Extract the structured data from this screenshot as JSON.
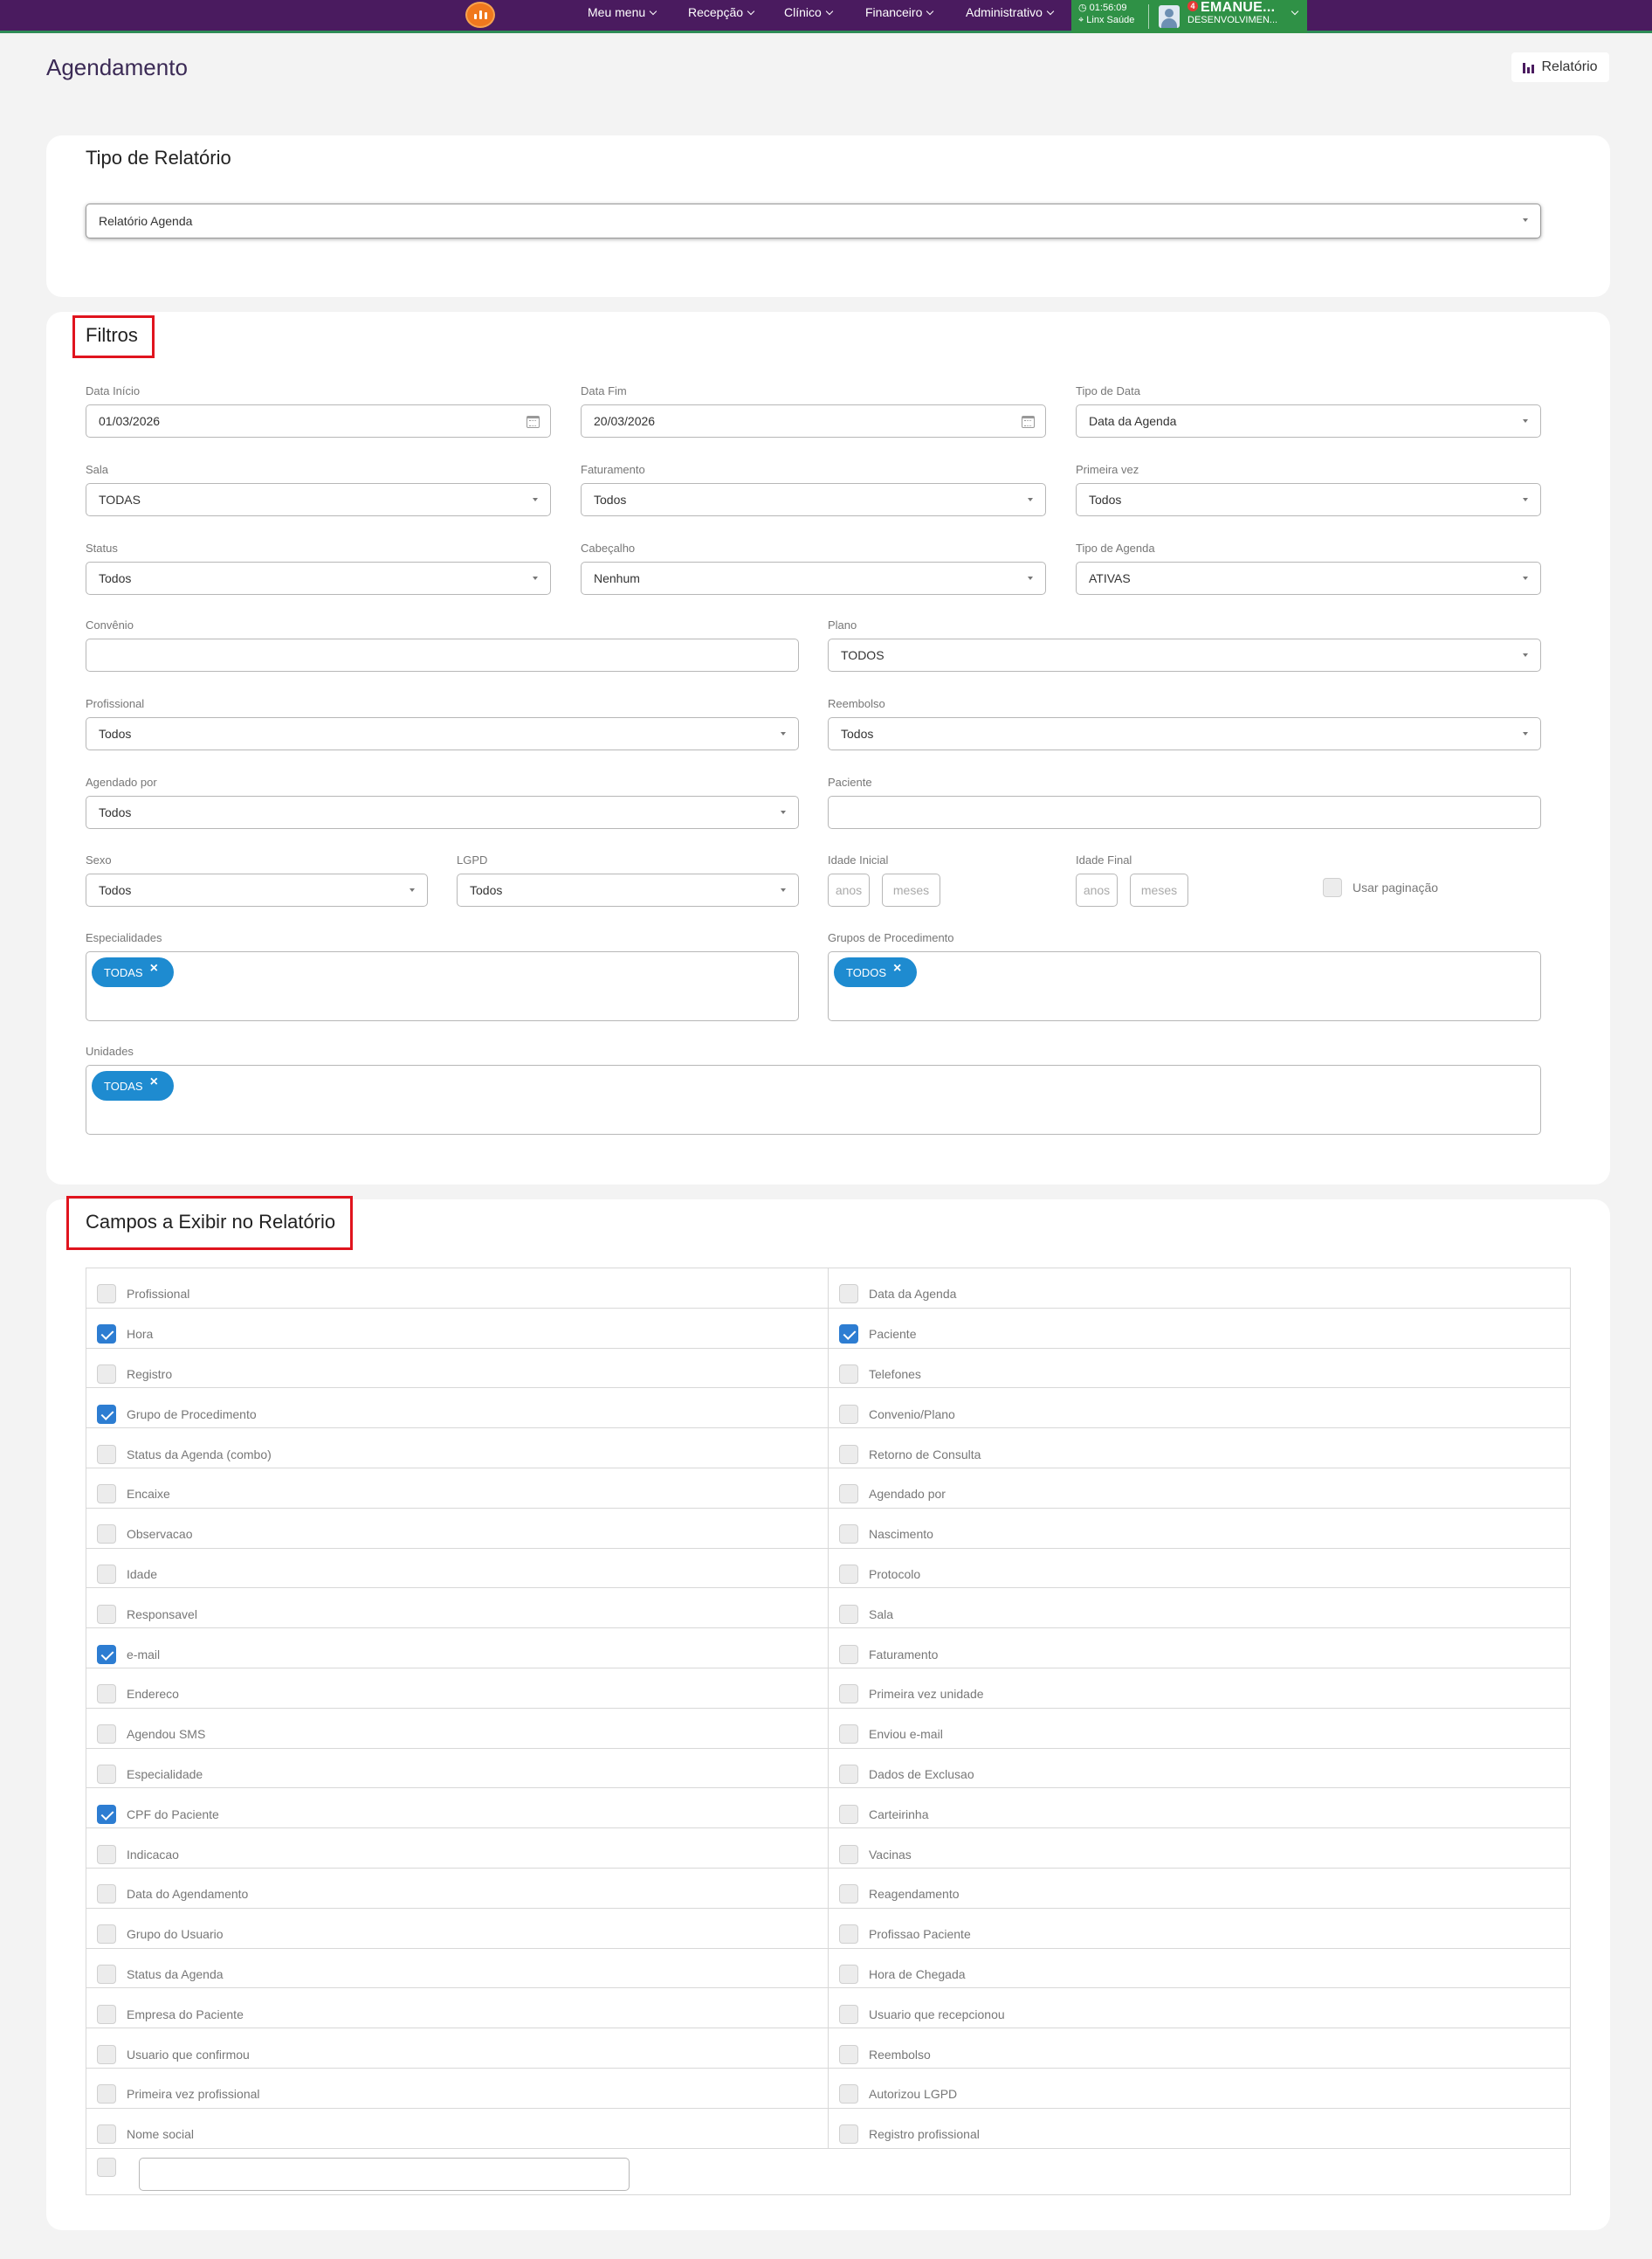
{
  "nav": {
    "menus": [
      "Meu menu",
      "Recepção",
      "Clínico",
      "Financeiro",
      "Administrativo"
    ],
    "time": "01:56:09",
    "location": "Linx Saúde",
    "notif_count": "4",
    "user_name": "EMANUE...",
    "user_role": "DESENVOLVIMEN..."
  },
  "page": {
    "title": "Agendamento",
    "report_button": "Relatório"
  },
  "tipo": {
    "title": "Tipo de Relatório",
    "value": "Relatório Agenda"
  },
  "filtros": {
    "title": "Filtros",
    "data_inicio": {
      "label": "Data Início",
      "value": "01/03/2026"
    },
    "data_fim": {
      "label": "Data Fim",
      "value": "20/03/2026"
    },
    "tipo_data": {
      "label": "Tipo de Data",
      "value": "Data da Agenda"
    },
    "sala": {
      "label": "Sala",
      "value": "TODAS"
    },
    "faturamento": {
      "label": "Faturamento",
      "value": "Todos"
    },
    "primeira_vez": {
      "label": "Primeira vez",
      "value": "Todos"
    },
    "status": {
      "label": "Status",
      "value": "Todos"
    },
    "cabecalho": {
      "label": "Cabeçalho",
      "value": "Nenhum"
    },
    "tipo_agenda": {
      "label": "Tipo de Agenda",
      "value": "ATIVAS"
    },
    "convenio": {
      "label": "Convênio",
      "value": ""
    },
    "plano": {
      "label": "Plano",
      "value": "TODOS"
    },
    "profissional": {
      "label": "Profissional",
      "value": "Todos"
    },
    "reembolso": {
      "label": "Reembolso",
      "value": "Todos"
    },
    "agendado_por": {
      "label": "Agendado por",
      "value": "Todos"
    },
    "paciente": {
      "label": "Paciente",
      "value": ""
    },
    "sexo": {
      "label": "Sexo",
      "value": "Todos"
    },
    "lgpd": {
      "label": "LGPD",
      "value": "Todos"
    },
    "idade_inicial": {
      "label": "Idade Inicial",
      "anos_placeholder": "anos",
      "meses_placeholder": "meses"
    },
    "idade_final": {
      "label": "Idade Final",
      "anos_placeholder": "anos",
      "meses_placeholder": "meses"
    },
    "usar_paginacao": {
      "label": "Usar paginação",
      "checked": false
    },
    "especialidades": {
      "label": "Especialidades",
      "tag": "TODAS"
    },
    "grupos_procedimento": {
      "label": "Grupos de Procedimento",
      "tag": "TODOS"
    },
    "unidades": {
      "label": "Unidades",
      "tag": "TODAS"
    }
  },
  "campos": {
    "title": "Campos a Exibir no Relatório",
    "rows": [
      [
        {
          "label": "Profissional",
          "checked": false
        },
        {
          "label": "Data da Agenda",
          "checked": false
        }
      ],
      [
        {
          "label": "Hora",
          "checked": true
        },
        {
          "label": "Paciente",
          "checked": true
        }
      ],
      [
        {
          "label": "Registro",
          "checked": false
        },
        {
          "label": "Telefones",
          "checked": false
        }
      ],
      [
        {
          "label": "Grupo de Procedimento",
          "checked": true
        },
        {
          "label": "Convenio/Plano",
          "checked": false
        }
      ],
      [
        {
          "label": "Status da Agenda (combo)",
          "checked": false
        },
        {
          "label": "Retorno de Consulta",
          "checked": false
        }
      ],
      [
        {
          "label": "Encaixe",
          "checked": false
        },
        {
          "label": "Agendado por",
          "checked": false
        }
      ],
      [
        {
          "label": "Observacao",
          "checked": false
        },
        {
          "label": "Nascimento",
          "checked": false
        }
      ],
      [
        {
          "label": "Idade",
          "checked": false
        },
        {
          "label": "Protocolo",
          "checked": false
        }
      ],
      [
        {
          "label": "Responsavel",
          "checked": false
        },
        {
          "label": "Sala",
          "checked": false
        }
      ],
      [
        {
          "label": "e-mail",
          "checked": true
        },
        {
          "label": "Faturamento",
          "checked": false
        }
      ],
      [
        {
          "label": "Endereco",
          "checked": false
        },
        {
          "label": "Primeira vez unidade",
          "checked": false
        }
      ],
      [
        {
          "label": "Agendou SMS",
          "checked": false
        },
        {
          "label": "Enviou e-mail",
          "checked": false
        }
      ],
      [
        {
          "label": "Especialidade",
          "checked": false
        },
        {
          "label": "Dados de Exclusao",
          "checked": false
        }
      ],
      [
        {
          "label": "CPF do Paciente",
          "checked": true
        },
        {
          "label": "Carteirinha",
          "checked": false
        }
      ],
      [
        {
          "label": "Indicacao",
          "checked": false
        },
        {
          "label": "Vacinas",
          "checked": false
        }
      ],
      [
        {
          "label": "Data do Agendamento",
          "checked": false
        },
        {
          "label": "Reagendamento",
          "checked": false
        }
      ],
      [
        {
          "label": "Grupo do Usuario",
          "checked": false
        },
        {
          "label": "Profissao Paciente",
          "checked": false
        }
      ],
      [
        {
          "label": "Status da Agenda",
          "checked": false
        },
        {
          "label": "Hora de Chegada",
          "checked": false
        }
      ],
      [
        {
          "label": "Empresa do Paciente",
          "checked": false
        },
        {
          "label": "Usuario que recepcionou",
          "checked": false
        }
      ],
      [
        {
          "label": "Usuario que confirmou",
          "checked": false
        },
        {
          "label": "Reembolso",
          "checked": false
        }
      ],
      [
        {
          "label": "Primeira vez profissional",
          "checked": false
        },
        {
          "label": "Autorizou LGPD",
          "checked": false
        }
      ],
      [
        {
          "label": "Nome social",
          "checked": false
        },
        {
          "label": "Registro profissional",
          "checked": false
        }
      ]
    ],
    "custom_field_value": ""
  },
  "colors": {
    "nav_bg": "#4a1b5f",
    "nav_green": "#2f9146",
    "tag_blue": "#1e8bd0",
    "check_blue": "#2d7dd2",
    "highlight_red": "#e0141e"
  }
}
